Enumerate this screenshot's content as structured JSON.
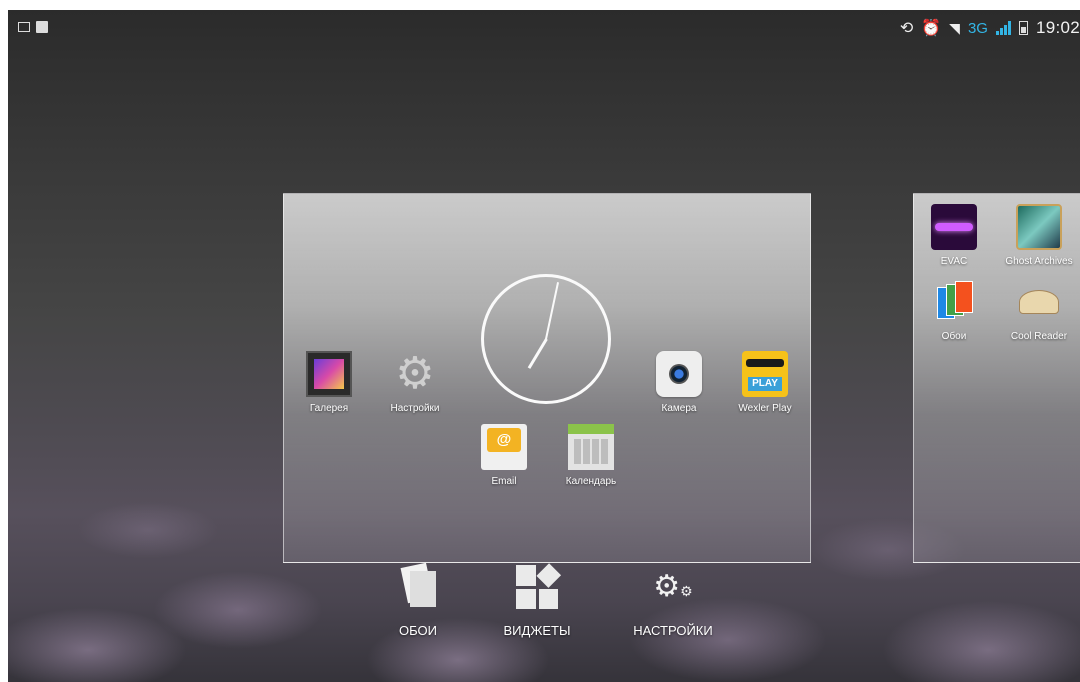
{
  "status_bar": {
    "time": "19:02",
    "network": "3G",
    "icons": [
      "picture-icon",
      "clipboard-check-icon",
      "rotate-icon",
      "alarm-icon",
      "wifi-icon",
      "signal-icon",
      "battery-icon"
    ]
  },
  "main_panel": {
    "clock": {
      "hour": 7,
      "minute": 2
    },
    "apps": [
      {
        "label": "Галерея",
        "icon": "gallery-icon"
      },
      {
        "label": "Настройки",
        "icon": "settings-icon"
      },
      {
        "label": "Камера",
        "icon": "camera-icon"
      },
      {
        "label": "Wexler Play",
        "icon": "wexler-play-icon"
      },
      {
        "label": "Email",
        "icon": "email-icon"
      },
      {
        "label": "Календарь",
        "icon": "calendar-icon"
      }
    ],
    "wexler_play_badge": "PLAY",
    "email_glyph": "@"
  },
  "right_panel": {
    "apps": [
      {
        "label": "EVAC",
        "icon": "evac-icon"
      },
      {
        "label": "Ghost Archives",
        "icon": "ghost-archives-icon"
      },
      {
        "label": "Обои",
        "icon": "wallpapers-icon"
      },
      {
        "label": "Cool Reader",
        "icon": "cool-reader-icon"
      }
    ]
  },
  "bottom_bar": {
    "wallpapers_label": "ОБОИ",
    "widgets_label": "ВИДЖЕТЫ",
    "settings_label": "НАСТРОЙКИ"
  },
  "colors": {
    "accent_blue": "#33b5e5",
    "text": "#ffffff"
  }
}
